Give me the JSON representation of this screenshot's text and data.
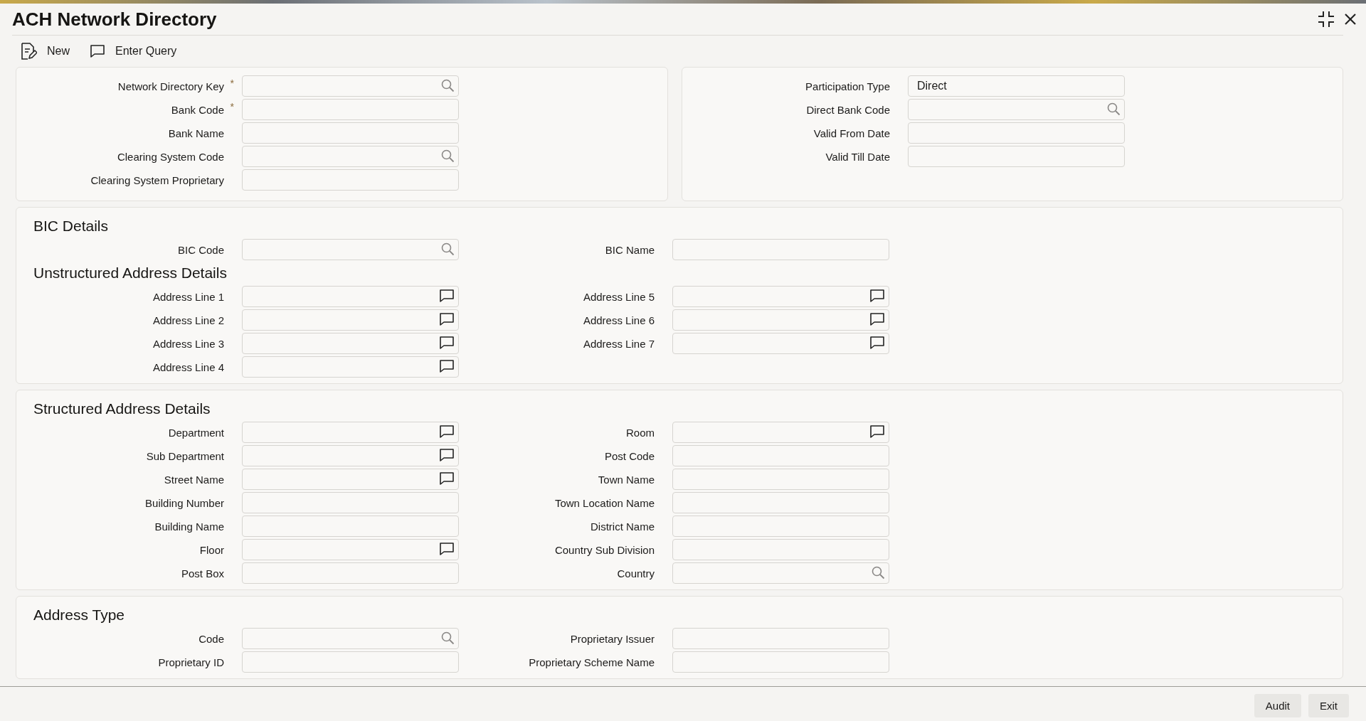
{
  "window": {
    "title": "ACH Network Directory"
  },
  "toolbar": [
    {
      "kind": "new",
      "label": "New"
    },
    {
      "kind": "query",
      "label": "Enter Query"
    }
  ],
  "header_panels": [
    {
      "fields": [
        {
          "label": "Network Directory Key",
          "required_mark": "*",
          "kind": "search"
        },
        {
          "label": "Bank Code",
          "required_mark": "*",
          "kind": "text"
        },
        {
          "label": "Bank Name",
          "kind": "text"
        },
        {
          "label": "Clearing System Code",
          "kind": "search"
        },
        {
          "label": "Clearing System Proprietary",
          "kind": "text"
        }
      ]
    },
    {
      "fields": [
        {
          "label": "Participation Type",
          "kind": "text",
          "value": "Direct"
        },
        {
          "label": "Direct Bank Code",
          "kind": "search"
        },
        {
          "label": "Valid From Date",
          "kind": "text"
        },
        {
          "label": "Valid Till Date",
          "kind": "text"
        }
      ]
    }
  ],
  "sections": [
    {
      "groups": [
        {
          "title": "BIC Details",
          "left": [
            {
              "label": "BIC Code",
              "kind": "search"
            }
          ],
          "right": [
            {
              "label": "BIC Name",
              "kind": "text"
            }
          ]
        },
        {
          "title": "Unstructured Address Details",
          "left": [
            {
              "label": "Address Line 1",
              "kind": "comment"
            },
            {
              "label": "Address Line 2",
              "kind": "comment"
            },
            {
              "label": "Address Line 3",
              "kind": "comment"
            },
            {
              "label": "Address Line 4",
              "kind": "comment"
            }
          ],
          "right": [
            {
              "label": "Address Line 5",
              "kind": "comment"
            },
            {
              "label": "Address Line 6",
              "kind": "comment"
            },
            {
              "label": "Address Line 7",
              "kind": "comment"
            }
          ]
        }
      ]
    },
    {
      "groups": [
        {
          "title": "Structured Address Details",
          "left": [
            {
              "label": "Department",
              "kind": "comment"
            },
            {
              "label": "Sub Department",
              "kind": "comment"
            },
            {
              "label": "Street Name",
              "kind": "comment"
            },
            {
              "label": "Building Number",
              "kind": "text"
            },
            {
              "label": "Building Name",
              "kind": "text"
            },
            {
              "label": "Floor",
              "kind": "comment"
            },
            {
              "label": "Post Box",
              "kind": "text"
            }
          ],
          "right": [
            {
              "label": "Room",
              "kind": "comment"
            },
            {
              "label": "Post Code",
              "kind": "text"
            },
            {
              "label": "Town Name",
              "kind": "text"
            },
            {
              "label": "Town Location Name",
              "kind": "text"
            },
            {
              "label": "District Name",
              "kind": "text"
            },
            {
              "label": "Country Sub Division",
              "kind": "text"
            },
            {
              "label": "Country",
              "kind": "search"
            }
          ]
        }
      ]
    },
    {
      "groups": [
        {
          "title": "Address Type",
          "left": [
            {
              "label": "Code",
              "kind": "search"
            },
            {
              "label": "Proprietary ID",
              "kind": "text"
            }
          ],
          "right": [
            {
              "label": "Proprietary Issuer",
              "kind": "text"
            },
            {
              "label": "Proprietary Scheme Name",
              "kind": "text"
            }
          ]
        }
      ]
    }
  ],
  "footer_buttons": [
    "Audit",
    "Exit"
  ]
}
